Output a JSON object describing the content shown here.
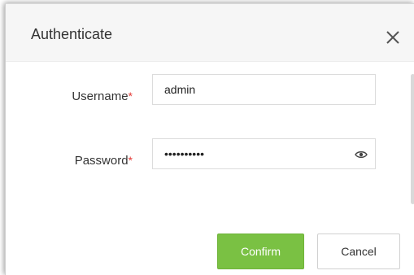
{
  "dialog": {
    "title": "Authenticate",
    "close_icon": "close-icon"
  },
  "form": {
    "username_label": "Username",
    "password_label": "Password",
    "required_mark": "*",
    "username_value": "admin",
    "password_value": "••••••••••",
    "password_toggle_icon": "eye-icon"
  },
  "buttons": {
    "confirm_label": "Confirm",
    "cancel_label": "Cancel"
  },
  "colors": {
    "confirm_bg": "#7ac143",
    "required": "#e53935",
    "header_bg": "#f6f6f6"
  }
}
